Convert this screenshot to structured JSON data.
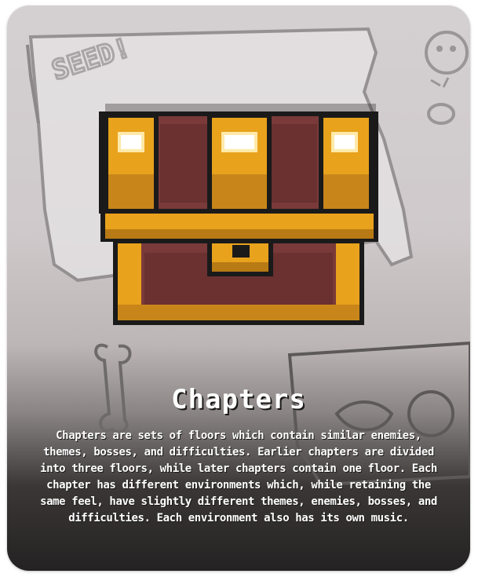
{
  "card": {
    "title": "Chapters",
    "description": "Chapters are sets of floors which contain similar enemies, themes, bosses, and difficulties. Earlier chapters are divided into three floors, while later chapters contain one floor. Each chapter has different environments which, while retaining the same feel, have slightly different themes, enemies, bosses, and difficulties. Each environment also has its own music.",
    "background_sketch_text": "SEED!",
    "icon": "treasure-chest-icon"
  },
  "colors": {
    "chest_gold": "#e8a21c",
    "chest_gold_dark": "#b87a14",
    "chest_wood": "#7a3a3a",
    "outline": "#1a1a1a",
    "text": "#ffffff"
  }
}
